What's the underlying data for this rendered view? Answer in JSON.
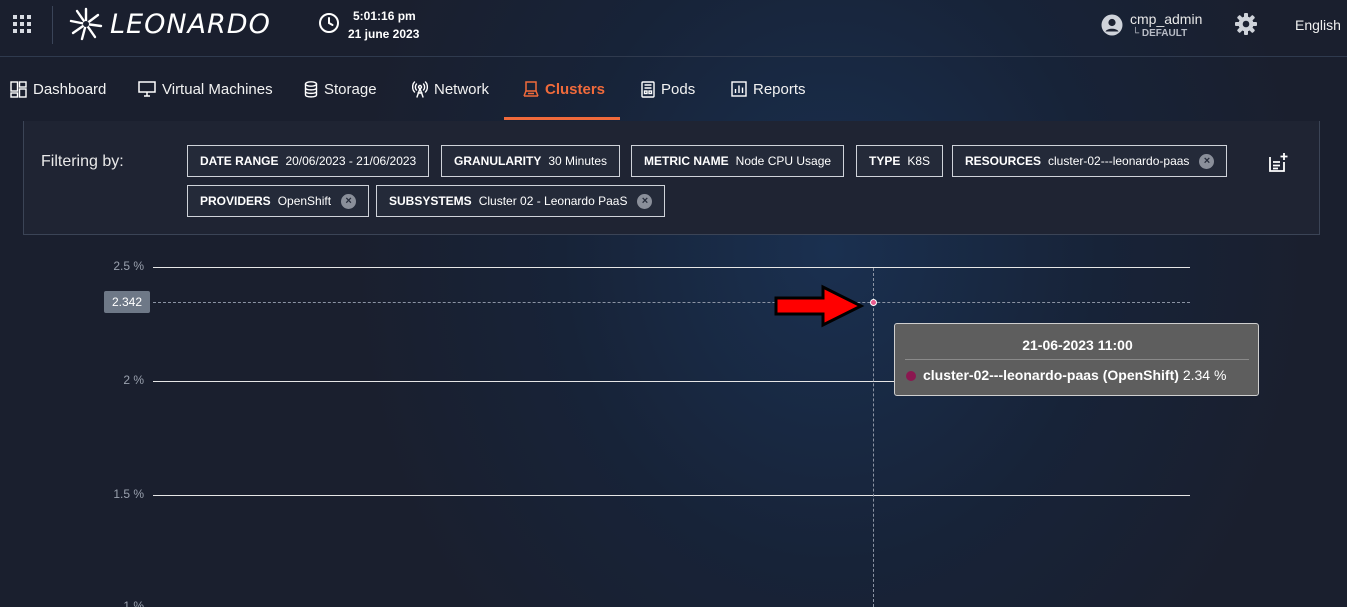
{
  "header": {
    "brand": "LEONARDO",
    "time": "5:01:16 pm",
    "date": "21 june 2023",
    "user_name": "cmp_admin",
    "user_tenant": "└ DEFAULT",
    "language": "English"
  },
  "nav": {
    "items": [
      {
        "label": "Dashboard",
        "icon": "dashboard-icon"
      },
      {
        "label": "Virtual Machines",
        "icon": "monitor-icon"
      },
      {
        "label": "Storage",
        "icon": "database-icon"
      },
      {
        "label": "Network",
        "icon": "antenna-icon"
      },
      {
        "label": "Clusters",
        "icon": "clusters-icon",
        "active": true
      },
      {
        "label": "Pods",
        "icon": "pods-icon"
      },
      {
        "label": "Reports",
        "icon": "reports-icon"
      }
    ]
  },
  "filters": {
    "title": "Filtering by:",
    "chips": [
      {
        "key": "DATE RANGE",
        "value": "20/06/2023 - 21/06/2023",
        "removable": false
      },
      {
        "key": "GRANULARITY",
        "value": "30 Minutes",
        "removable": false
      },
      {
        "key": "METRIC NAME",
        "value": "Node CPU Usage",
        "removable": false
      },
      {
        "key": "TYPE",
        "value": "K8S",
        "removable": false
      },
      {
        "key": "RESOURCES",
        "value": "cluster-02---leonardo-paas",
        "removable": true
      },
      {
        "key": "PROVIDERS",
        "value": "OpenShift",
        "removable": true
      },
      {
        "key": "SUBSYSTEMS",
        "value": "Cluster 02 - Leonardo PaaS",
        "removable": true
      }
    ]
  },
  "chart_data": {
    "type": "line",
    "title": "",
    "xlabel": "",
    "ylabel": "",
    "y_ticks": [
      "2.5 %",
      "2 %",
      "1.5 %",
      "1 %"
    ],
    "grid": true,
    "series": [
      {
        "name": "cluster-02---leonardo-paas (OpenShift)",
        "color": "#8b1750",
        "points": [
          {
            "x": "21-06-2023 11:00",
            "y": 2.34
          }
        ]
      }
    ],
    "crosshair_value": "2.342",
    "tooltip": {
      "title": "21-06-2023 11:00",
      "series": "cluster-02---leonardo-paas (OpenShift)",
      "value": "2.34 %"
    }
  },
  "colors": {
    "accent": "#f06a3b",
    "series": "#8b1750",
    "annotation_arrow": "#ff0000"
  }
}
